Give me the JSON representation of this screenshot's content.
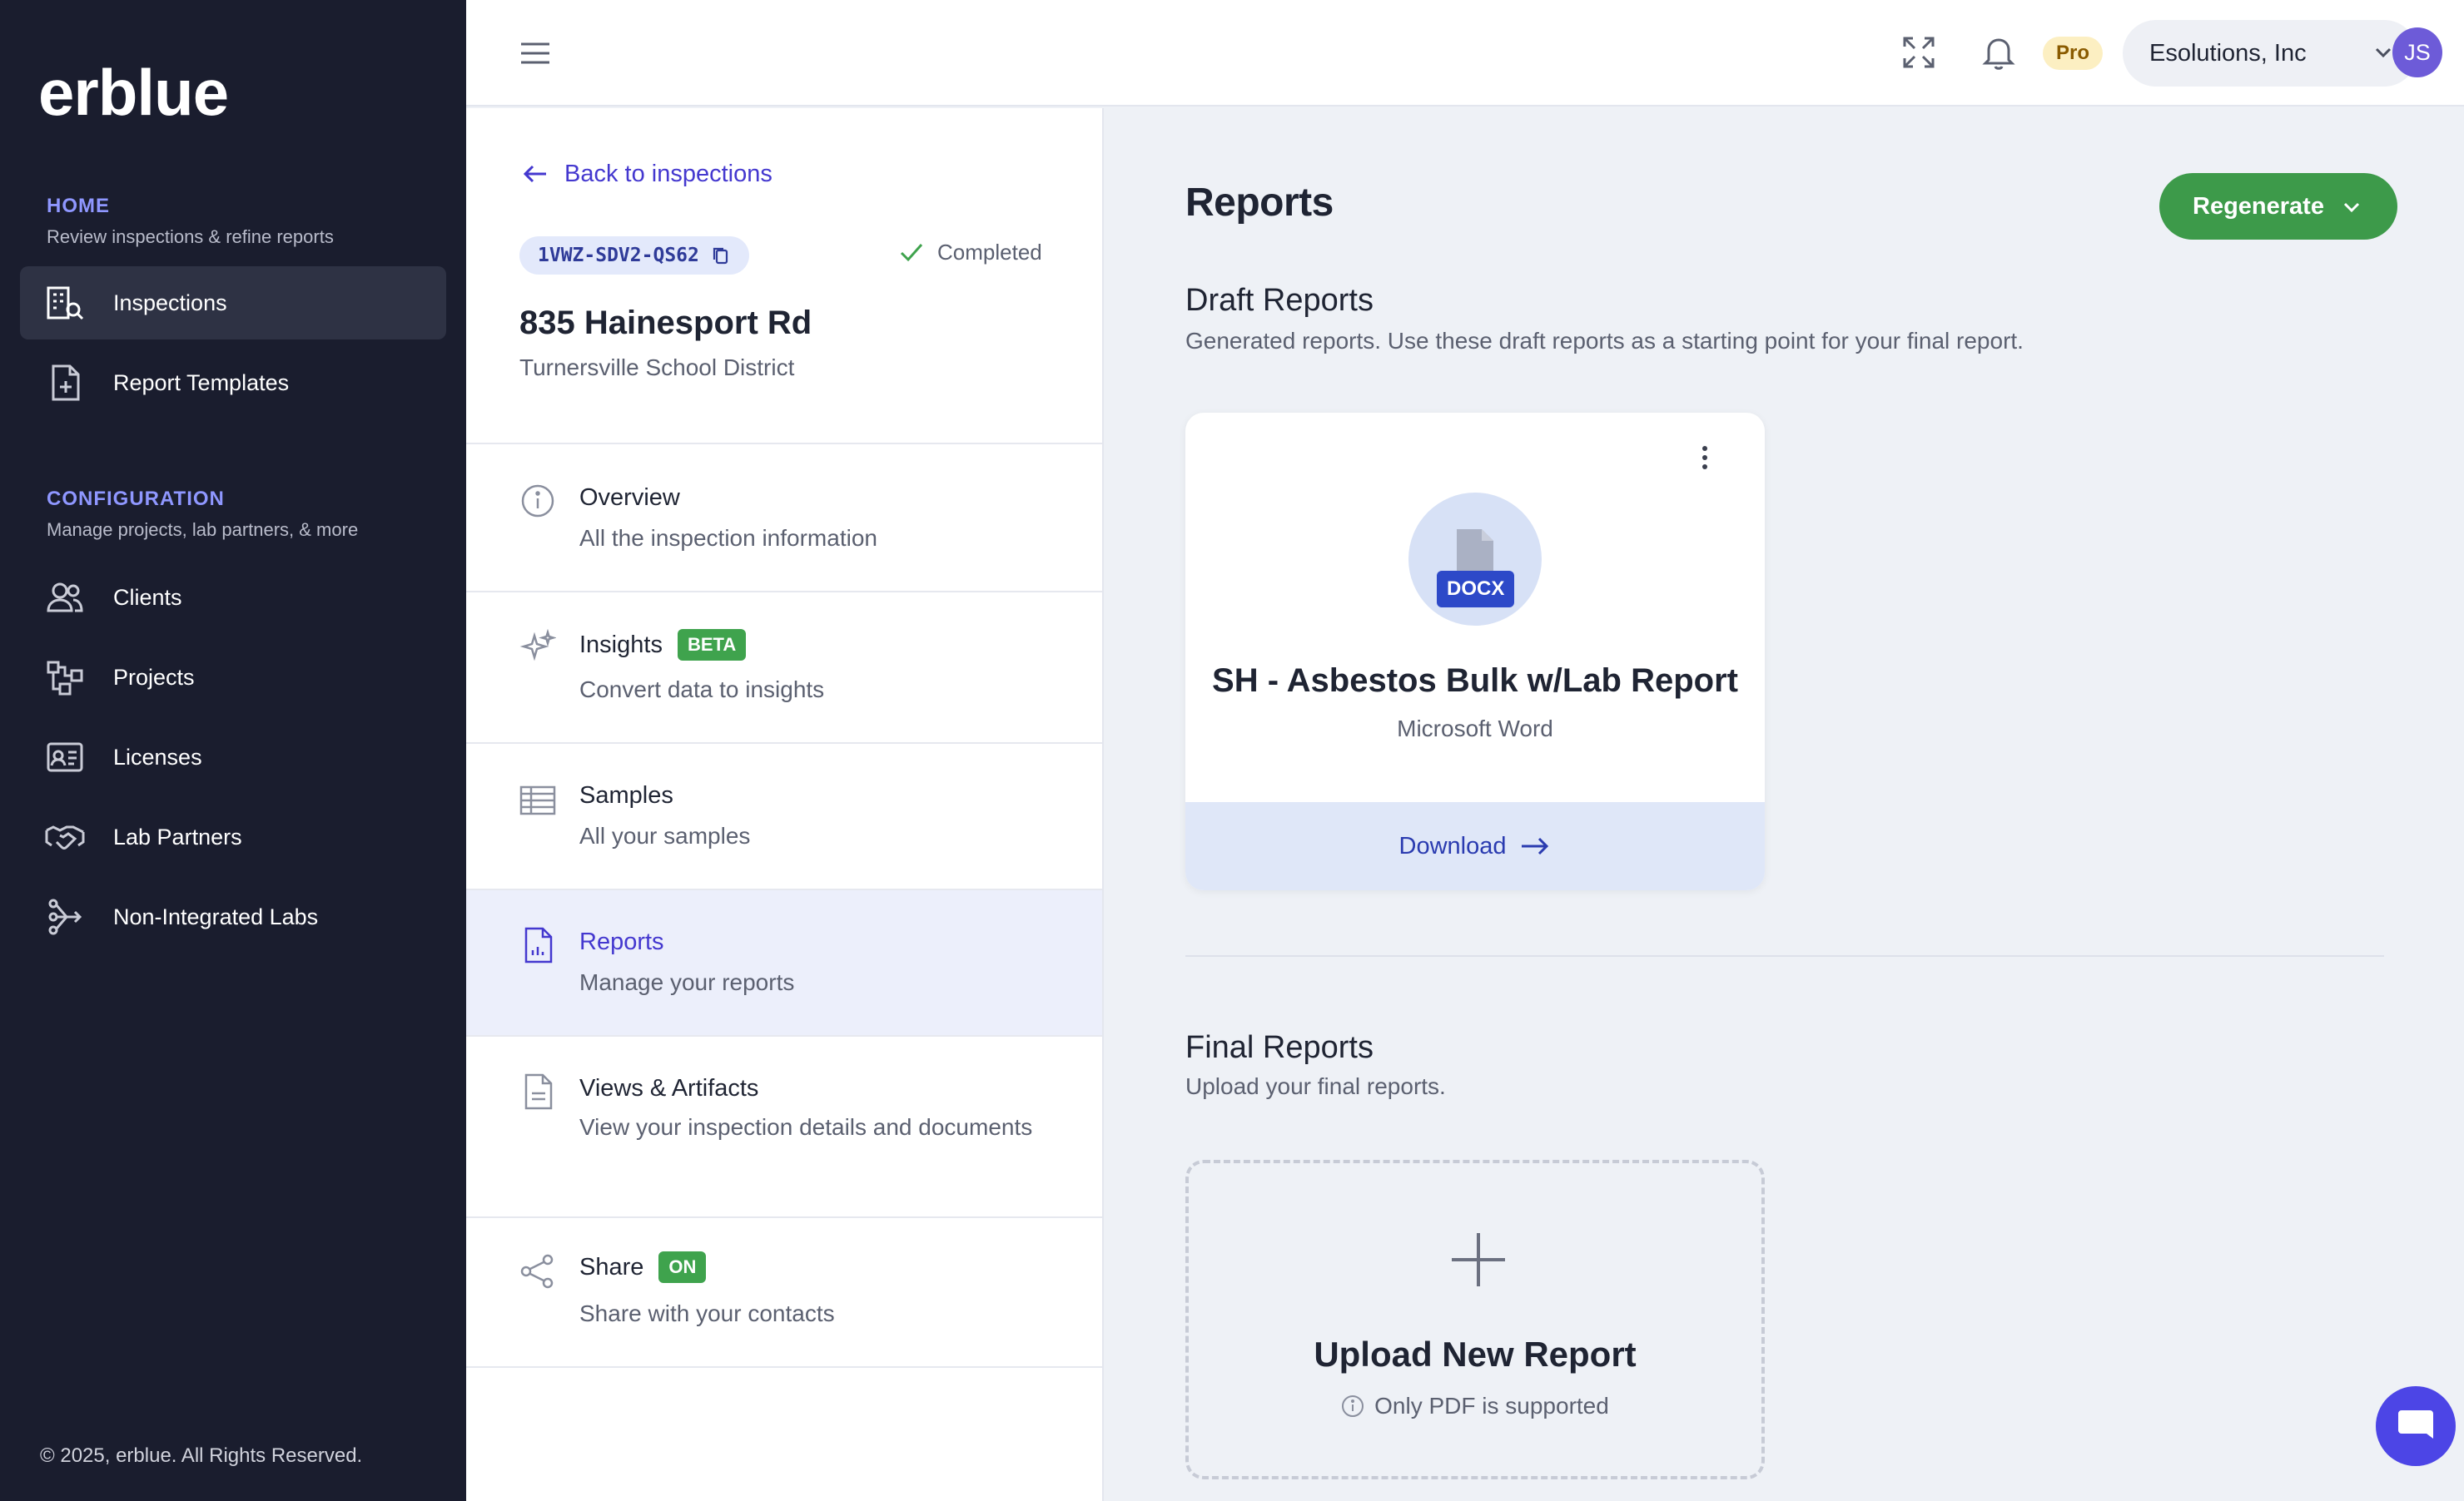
{
  "sidebar": {
    "logo": "erblue",
    "home": {
      "title": "HOME",
      "subtitle": "Review inspections & refine reports"
    },
    "home_items": [
      {
        "label": "Inspections",
        "icon": "building-search-icon",
        "active": true
      },
      {
        "label": "Report Templates",
        "icon": "file-plus-icon",
        "active": false
      }
    ],
    "config": {
      "title": "CONFIGURATION",
      "subtitle": "Manage projects, lab partners, & more"
    },
    "config_items": [
      {
        "label": "Clients",
        "icon": "users-icon"
      },
      {
        "label": "Projects",
        "icon": "hierarchy-icon"
      },
      {
        "label": "Licenses",
        "icon": "id-card-icon"
      },
      {
        "label": "Lab Partners",
        "icon": "handshake-icon"
      },
      {
        "label": "Non-Integrated Labs",
        "icon": "branch-arrow-icon"
      }
    ],
    "footer": "© 2025, erblue. All Rights Reserved."
  },
  "topbar": {
    "plan_badge": "Pro",
    "organization": "Esolutions, Inc",
    "avatar_initials": "JS"
  },
  "inspection": {
    "back_label": "Back to inspections",
    "id": "1VWZ-SDV2-QS62",
    "status": "Completed",
    "address": "835 Hainesport Rd",
    "district": "Turnersville School District",
    "menu": [
      {
        "title": "Overview",
        "subtitle": "All the inspection information",
        "icon": "info-icon"
      },
      {
        "title": "Insights",
        "badge": "BETA",
        "subtitle": "Convert data to insights",
        "icon": "sparkles-icon"
      },
      {
        "title": "Samples",
        "subtitle": "All your samples",
        "icon": "table-icon"
      },
      {
        "title": "Reports",
        "subtitle": "Manage your reports",
        "icon": "report-icon",
        "active": true
      },
      {
        "title": "Views & Artifacts",
        "subtitle": "View your inspection details and documents",
        "icon": "document-icon"
      },
      {
        "title": "Share",
        "badge": "ON",
        "subtitle": "Share with your contacts",
        "icon": "share-icon"
      }
    ]
  },
  "main": {
    "title": "Reports",
    "regenerate_label": "Regenerate",
    "draft": {
      "title": "Draft Reports",
      "subtitle": "Generated reports. Use these draft reports as a starting point for your final report.",
      "card": {
        "file_type": "DOCX",
        "name": "SH - Asbestos Bulk w/Lab Report",
        "app": "Microsoft Word",
        "download_label": "Download"
      }
    },
    "final": {
      "title": "Final Reports",
      "subtitle": "Upload your final reports.",
      "upload_title": "Upload New Report",
      "upload_note": "Only PDF is supported"
    }
  },
  "colors": {
    "sidebar_bg": "#1a1d2e",
    "accent": "#4438cf",
    "success": "#3d9a4a",
    "pro_bg": "#fcefc2"
  }
}
